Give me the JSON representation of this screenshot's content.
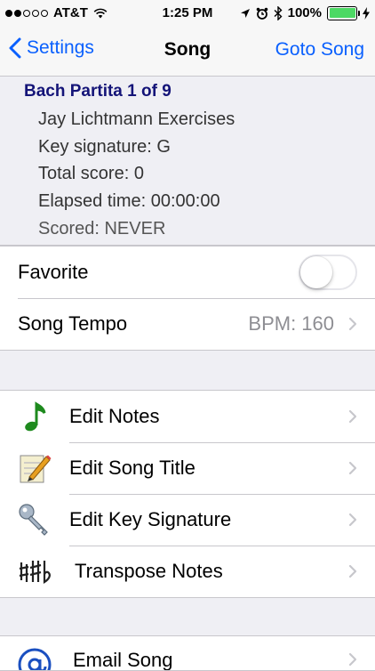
{
  "status": {
    "carrier": "AT&T",
    "time": "1:25 PM",
    "battery": "100%"
  },
  "nav": {
    "back_label": "Settings",
    "title": "Song",
    "right_label": "Goto Song"
  },
  "song": {
    "title": "Bach Partita 1 of 9",
    "lines": [
      "Jay Lichtmann Exercises",
      "Key signature: G",
      "Total score: 0",
      "Elapsed time: 00:00:00",
      "Scored: NEVER"
    ]
  },
  "settings": {
    "favorite_label": "Favorite",
    "favorite_on": false,
    "tempo_label": "Song Tempo",
    "tempo_value": "BPM: 160"
  },
  "actions": [
    {
      "label": "Edit Notes",
      "icon": "music-note-icon"
    },
    {
      "label": "Edit Song Title",
      "icon": "pencil-icon"
    },
    {
      "label": "Edit Key Signature",
      "icon": "key-icon"
    },
    {
      "label": "Transpose Notes",
      "icon": "accidentals-icon"
    }
  ],
  "share": [
    {
      "label": "Email Song",
      "icon": "at-sign-icon"
    }
  ],
  "colors": {
    "tint": "#0a60fe",
    "title_navy": "#141478",
    "battery": "#4cd964"
  }
}
